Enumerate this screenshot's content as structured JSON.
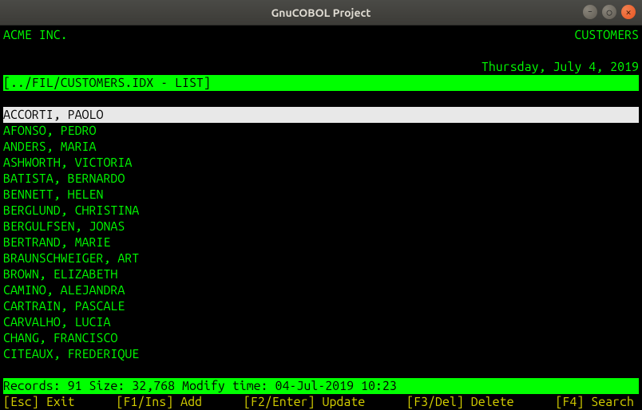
{
  "window": {
    "title": "GnuCOBOL Project"
  },
  "header": {
    "left": "ACME INC.",
    "right": "CUSTOMERS",
    "date": "Thursday, July 4, 2019"
  },
  "path_bar": "[../FIL/CUSTOMERS.IDX - LIST]",
  "list": {
    "selected_index": 0,
    "items": [
      "ACCORTI, PAOLO",
      "AFONSO, PEDRO",
      "ANDERS, MARIA",
      "ASHWORTH, VICTORIA",
      "BATISTA, BERNARDO",
      "BENNETT, HELEN",
      "BERGLUND, CHRISTINA",
      "BERGULFSEN, JONAS",
      "BERTRAND, MARIE",
      "BRAUNSCHWEIGER, ART",
      "BROWN, ELIZABETH",
      "CAMINO, ALEJANDRA",
      "CARTRAIN, PASCALE",
      "CARVALHO, LUCIA",
      "CHANG, FRANCISCO",
      "CITEAUX, FREDERIQUE"
    ]
  },
  "status_bar": "Records: 91 Size: 32,768 Modify time: 04-Jul-2019 10:23",
  "hotkeys": [
    "[Esc] Exit",
    "[F1/Ins] Add",
    "[F2/Enter] Update",
    "[F3/Del] Delete",
    "[F4] Search"
  ]
}
